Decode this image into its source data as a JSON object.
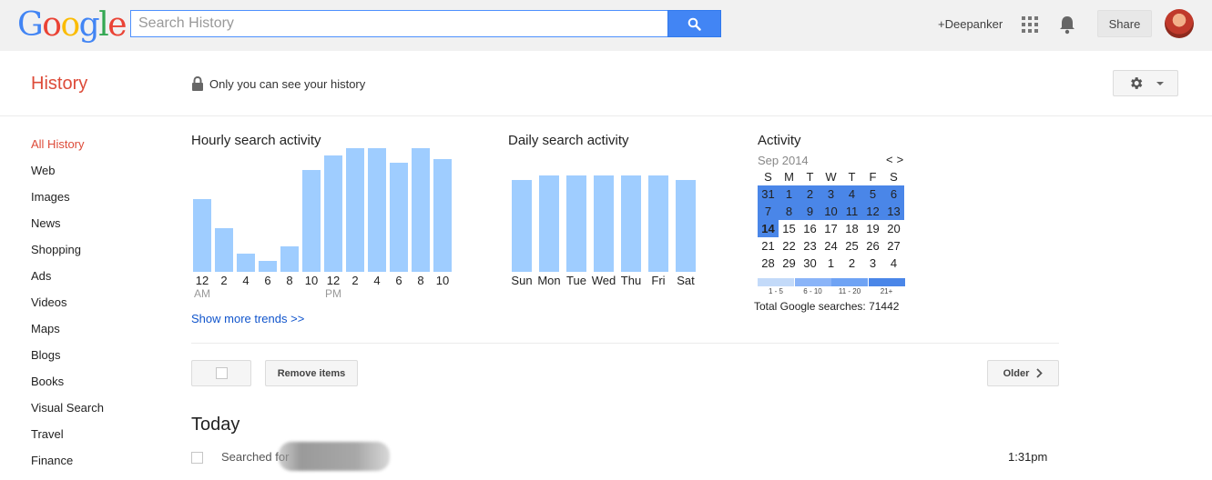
{
  "header": {
    "logo_letters": [
      "G",
      "o",
      "o",
      "g",
      "l",
      "e"
    ],
    "search_placeholder": "Search History",
    "user_link": "+Deepanker",
    "share_label": "Share"
  },
  "page": {
    "title": "History",
    "privacy_note": "Only you can see your history"
  },
  "sidebar": {
    "items": [
      {
        "label": "All History",
        "active": true
      },
      {
        "label": "Web"
      },
      {
        "label": "Images"
      },
      {
        "label": "News"
      },
      {
        "label": "Shopping"
      },
      {
        "label": "Ads"
      },
      {
        "label": "Videos"
      },
      {
        "label": "Maps"
      },
      {
        "label": "Blogs"
      },
      {
        "label": "Books"
      },
      {
        "label": "Visual Search"
      },
      {
        "label": "Travel"
      },
      {
        "label": "Finance"
      }
    ]
  },
  "chart_data": [
    {
      "type": "bar",
      "title": "Hourly search activity",
      "categories": [
        "12",
        "2",
        "4",
        "6",
        "8",
        "10",
        "12",
        "2",
        "4",
        "6",
        "8",
        "10"
      ],
      "sub_labels": [
        "AM",
        "",
        "",
        "",
        "",
        "",
        "PM",
        "",
        "",
        "",
        "",
        ""
      ],
      "values": [
        100,
        60,
        25,
        15,
        35,
        140,
        160,
        170,
        170,
        150,
        170,
        155
      ],
      "ylim": [
        0,
        155
      ]
    },
    {
      "type": "bar",
      "title": "Daily search activity",
      "categories": [
        "Sun",
        "Mon",
        "Tue",
        "Wed",
        "Thu",
        "Fri",
        "Sat"
      ],
      "values": [
        100,
        105,
        105,
        105,
        105,
        105,
        100
      ],
      "ylim": [
        0,
        105
      ]
    }
  ],
  "activity": {
    "title": "Activity",
    "month": "Sep 2014",
    "nav_prev": "<",
    "nav_next": ">",
    "weekdays": [
      "S",
      "M",
      "T",
      "W",
      "T",
      "F",
      "S"
    ],
    "weeks": [
      [
        {
          "d": "31",
          "l": 4
        },
        {
          "d": "1",
          "l": 4
        },
        {
          "d": "2",
          "l": 4
        },
        {
          "d": "3",
          "l": 4
        },
        {
          "d": "4",
          "l": 4
        },
        {
          "d": "5",
          "l": 4
        },
        {
          "d": "6",
          "l": 4
        }
      ],
      [
        {
          "d": "7",
          "l": 4
        },
        {
          "d": "8",
          "l": 4
        },
        {
          "d": "9",
          "l": 4
        },
        {
          "d": "10",
          "l": 4
        },
        {
          "d": "11",
          "l": 4
        },
        {
          "d": "12",
          "l": 4
        },
        {
          "d": "13",
          "l": 4
        }
      ],
      [
        {
          "d": "14",
          "l": 4,
          "today": true
        },
        {
          "d": "15",
          "l": 0
        },
        {
          "d": "16",
          "l": 0
        },
        {
          "d": "17",
          "l": 0
        },
        {
          "d": "18",
          "l": 0
        },
        {
          "d": "19",
          "l": 0
        },
        {
          "d": "20",
          "l": 0
        }
      ],
      [
        {
          "d": "21",
          "l": 0
        },
        {
          "d": "22",
          "l": 0
        },
        {
          "d": "23",
          "l": 0
        },
        {
          "d": "24",
          "l": 0
        },
        {
          "d": "25",
          "l": 0
        },
        {
          "d": "26",
          "l": 0
        },
        {
          "d": "27",
          "l": 0
        }
      ],
      [
        {
          "d": "28",
          "l": 0
        },
        {
          "d": "29",
          "l": 0
        },
        {
          "d": "30",
          "l": 0
        },
        {
          "d": "1",
          "l": 0
        },
        {
          "d": "2",
          "l": 0
        },
        {
          "d": "3",
          "l": 0
        },
        {
          "d": "4",
          "l": 0
        }
      ]
    ],
    "legend": [
      "1 - 5",
      "6 - 10",
      "11 - 20",
      "21+"
    ],
    "total": "Total Google searches: 71442"
  },
  "trends_link": "Show more trends >>",
  "actions": {
    "remove_label": "Remove items",
    "older_label": "Older"
  },
  "today": {
    "title": "Today",
    "entries": [
      {
        "text": "Searched for",
        "time": "1:31pm"
      }
    ]
  },
  "colors": {
    "brand_red": "#dd4b39",
    "bar_blue": "#9fcdff",
    "calendar_strong": "#4a86e8",
    "link_blue": "#1155cc"
  }
}
